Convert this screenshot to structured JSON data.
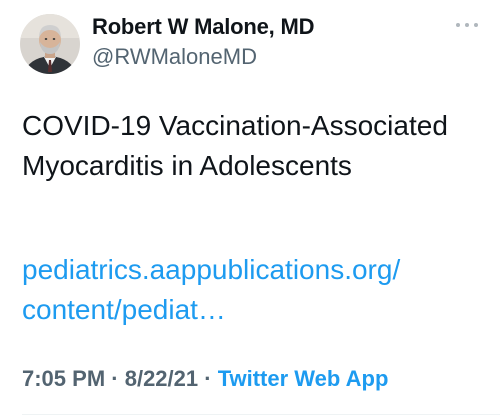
{
  "author": {
    "display_name": "Robert W Malone, MD",
    "handle": "@RWMaloneMD",
    "avatar_icon": "profile-photo"
  },
  "more_icon": "ellipsis-icon",
  "tweet": {
    "text": "COVID-19 Vaccination-Associated Myocarditis in Adolescents",
    "link_line1": "pediatrics.aappublications.org/",
    "link_line2": "content/pediat…"
  },
  "meta": {
    "time": "7:05 PM",
    "separator1": " · ",
    "date": "8/22/21",
    "separator2": " · ",
    "source": "Twitter Web App"
  },
  "colors": {
    "text": "#0f1419",
    "secondary": "#536471",
    "link": "#1d9bf0"
  }
}
